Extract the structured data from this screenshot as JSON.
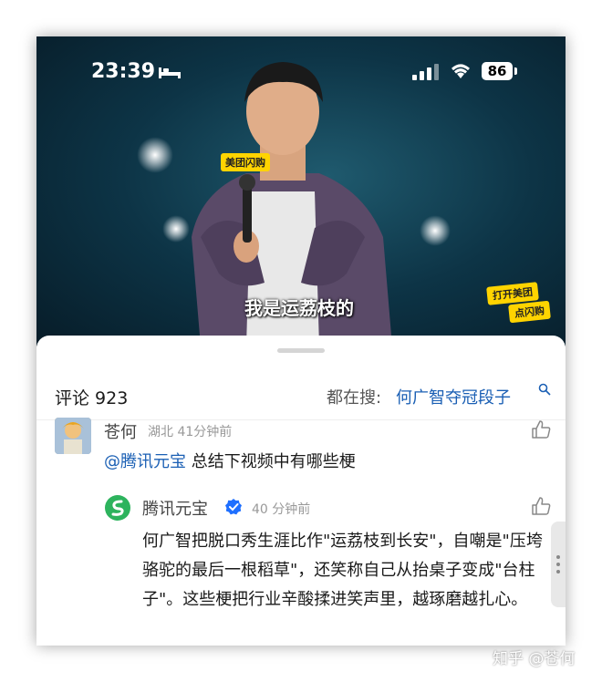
{
  "status_bar": {
    "time": "23:39",
    "battery": "86",
    "icons": [
      "bed-icon",
      "signal-icon",
      "wifi-icon",
      "battery-icon"
    ]
  },
  "video": {
    "mic_logo": "美团闪购",
    "subtitle": "我是运荔枝的",
    "promo_line1": "打开美团",
    "promo_line2": "点闪购"
  },
  "comments_header": {
    "count_label": "评论 923",
    "search_prefix": "都在搜:",
    "search_term": "何广智夺冠段子"
  },
  "comments": [
    {
      "user": "苍何",
      "meta": "湖北 41分钟前",
      "mention": "@腾讯元宝",
      "text": " 总结下视频中有哪些梗"
    },
    {
      "user": "腾讯元宝",
      "meta": "40 分钟前",
      "text": "何广智把脱口秀生涯比作\"运荔枝到长安\"，自嘲是\"压垮骆驼的最后一根稻草\"，还笑称自己从抬桌子变成\"台柱子\"。这些梗把行业辛酸揉进笑声里，越琢磨越扎心。"
    }
  ],
  "watermark": "知乎 @苍何",
  "colors": {
    "link": "#1a5fb4",
    "promo": "#ffd400",
    "verified": "#1e6fff",
    "yuanbao": "#2db35d"
  }
}
